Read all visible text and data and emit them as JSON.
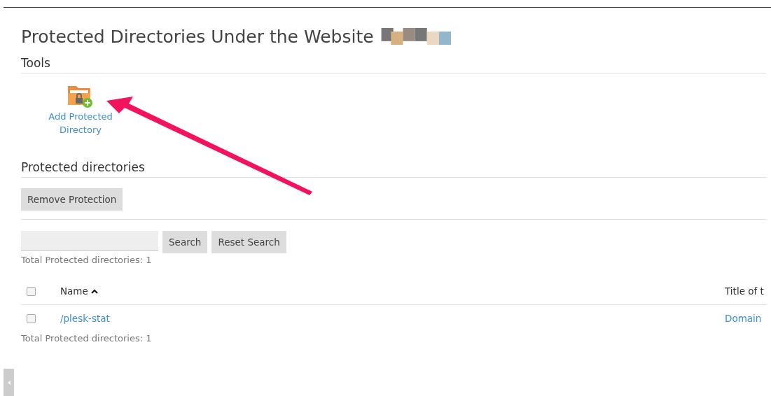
{
  "page_title": "Protected Directories Under the Website",
  "tools": {
    "heading": "Tools",
    "items": [
      {
        "label": "Add Protected Directory"
      }
    ]
  },
  "list": {
    "heading": "Protected directories",
    "actions": [
      "Remove Protection"
    ],
    "search": {
      "buttons": [
        "Search",
        "Reset Search"
      ]
    },
    "total_top": "Total Protected directories: 1",
    "table": {
      "select_all_checked": false,
      "columns": [
        {
          "label": "Name",
          "sorted": true
        },
        {
          "label": "Title of t",
          "sorted": false
        }
      ],
      "rows": [
        {
          "checked": false,
          "cells": [
            "/plesk-stat",
            "Domain"
          ]
        }
      ]
    },
    "total_bottom": "Total Protected directories: 1"
  }
}
